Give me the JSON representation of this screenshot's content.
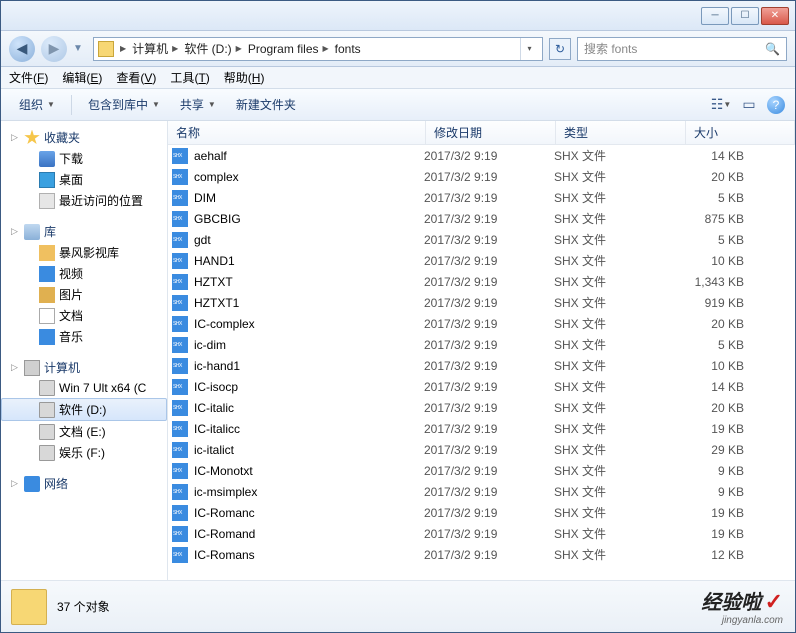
{
  "breadcrumbs": [
    "计算机",
    "软件 (D:)",
    "Program files",
    "fonts"
  ],
  "search": {
    "placeholder": "搜索 fonts"
  },
  "menubar": [
    {
      "label": "文件",
      "key": "F"
    },
    {
      "label": "编辑",
      "key": "E"
    },
    {
      "label": "查看",
      "key": "V"
    },
    {
      "label": "工具",
      "key": "T"
    },
    {
      "label": "帮助",
      "key": "H"
    }
  ],
  "toolbar": {
    "organize": "组织",
    "include": "包含到库中",
    "share": "共享",
    "newfolder": "新建文件夹"
  },
  "tree": {
    "favorites": {
      "label": "收藏夹",
      "items": [
        {
          "label": "下载",
          "icon": "ic-dl"
        },
        {
          "label": "桌面",
          "icon": "ic-desk"
        },
        {
          "label": "最近访问的位置",
          "icon": "ic-recent"
        }
      ]
    },
    "libraries": {
      "label": "库",
      "items": [
        {
          "label": "暴风影视库",
          "icon": "ic-v"
        },
        {
          "label": "视频",
          "icon": "ic-vid"
        },
        {
          "label": "图片",
          "icon": "ic-pic"
        },
        {
          "label": "文档",
          "icon": "ic-doc"
        },
        {
          "label": "音乐",
          "icon": "ic-mus"
        }
      ]
    },
    "computer": {
      "label": "计算机",
      "items": [
        {
          "label": "Win 7 Ult x64 (C",
          "icon": "ic-drv"
        },
        {
          "label": "软件 (D:)",
          "icon": "ic-drv",
          "selected": true
        },
        {
          "label": "文档 (E:)",
          "icon": "ic-drv"
        },
        {
          "label": "娱乐 (F:)",
          "icon": "ic-drv"
        }
      ]
    },
    "network": {
      "label": "网络"
    }
  },
  "columns": {
    "name": "名称",
    "date": "修改日期",
    "type": "类型",
    "size": "大小"
  },
  "filetype": "SHX 文件",
  "filedate": "2017/3/2 9:19",
  "files": [
    {
      "name": "aehalf",
      "size": "14 KB"
    },
    {
      "name": "complex",
      "size": "20 KB"
    },
    {
      "name": "DIM",
      "size": "5 KB"
    },
    {
      "name": "GBCBIG",
      "size": "875 KB"
    },
    {
      "name": "gdt",
      "size": "5 KB"
    },
    {
      "name": "HAND1",
      "size": "10 KB"
    },
    {
      "name": "HZTXT",
      "size": "1,343 KB"
    },
    {
      "name": "HZTXT1",
      "size": "919 KB"
    },
    {
      "name": "IC-complex",
      "size": "20 KB"
    },
    {
      "name": "ic-dim",
      "size": "5 KB"
    },
    {
      "name": "ic-hand1",
      "size": "10 KB"
    },
    {
      "name": "IC-isocp",
      "size": "14 KB"
    },
    {
      "name": "IC-italic",
      "size": "20 KB"
    },
    {
      "name": "IC-italicc",
      "size": "19 KB"
    },
    {
      "name": "ic-italict",
      "size": "29 KB"
    },
    {
      "name": "IC-Monotxt",
      "size": "9 KB"
    },
    {
      "name": "ic-msimplex",
      "size": "9 KB"
    },
    {
      "name": "IC-Romanc",
      "size": "19 KB"
    },
    {
      "name": "IC-Romand",
      "size": "19 KB"
    },
    {
      "name": "IC-Romans",
      "size": "12 KB"
    }
  ],
  "status": {
    "count": "37 个对象"
  },
  "watermark": {
    "big": "经验啦",
    "check": "✓",
    "small": "jingyanla.com"
  }
}
